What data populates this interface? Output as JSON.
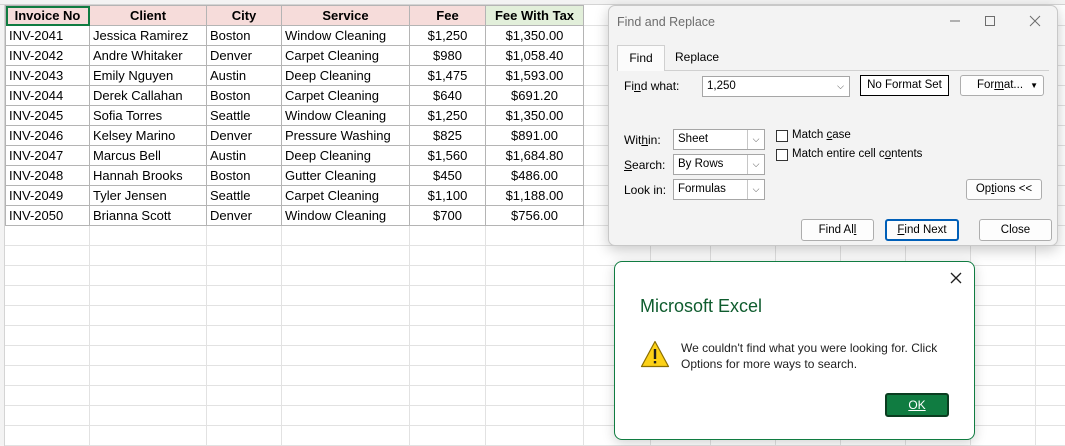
{
  "sheet": {
    "headers": [
      "Invoice No",
      "Client",
      "City",
      "Service",
      "Fee",
      "Fee With Tax"
    ],
    "rows": [
      [
        "INV-2041",
        "Jessica Ramirez",
        "Boston",
        "Window Cleaning",
        "$1,250",
        "$1,350.00"
      ],
      [
        "INV-2042",
        "Andre Whitaker",
        "Denver",
        "Carpet Cleaning",
        "$980",
        "$1,058.40"
      ],
      [
        "INV-2043",
        "Emily Nguyen",
        "Austin",
        "Deep Cleaning",
        "$1,475",
        "$1,593.00"
      ],
      [
        "INV-2044",
        "Derek Callahan",
        "Boston",
        "Carpet Cleaning",
        "$640",
        "$691.20"
      ],
      [
        "INV-2045",
        "Sofia Torres",
        "Seattle",
        "Window Cleaning",
        "$1,250",
        "$1,350.00"
      ],
      [
        "INV-2046",
        "Kelsey Marino",
        "Denver",
        "Pressure Washing",
        "$825",
        "$891.00"
      ],
      [
        "INV-2047",
        "Marcus Bell",
        "Austin",
        "Deep Cleaning",
        "$1,560",
        "$1,684.80"
      ],
      [
        "INV-2048",
        "Hannah Brooks",
        "Boston",
        "Gutter Cleaning",
        "$450",
        "$486.00"
      ],
      [
        "INV-2049",
        "Tyler Jensen",
        "Seattle",
        "Carpet Cleaning",
        "$1,100",
        "$1,188.00"
      ],
      [
        "INV-2050",
        "Brianna Scott",
        "Denver",
        "Window Cleaning",
        "$700",
        "$756.00"
      ]
    ]
  },
  "find_dialog": {
    "title": "Find and Replace",
    "tabs": {
      "find": "Find",
      "replace": "Replace"
    },
    "find_what": {
      "label_pre": "Fi",
      "label_key": "n",
      "label_post": "d what:",
      "value": "1,250"
    },
    "no_format": "No Format Set",
    "format_btn": {
      "pre": "For",
      "key": "m",
      "post": "at..."
    },
    "within": {
      "label_pre": "Wit",
      "label_key": "h",
      "label_post": "in:",
      "value": "Sheet"
    },
    "search": {
      "label_key": "S",
      "label_post": "earch:",
      "value": "By Rows"
    },
    "look_in": {
      "label_pre": "Look in:",
      "value": "Formulas"
    },
    "match_case": {
      "pre": "Match ",
      "key": "c",
      "post": "ase"
    },
    "match_entire": {
      "pre": "Match entire cell c",
      "key": "o",
      "post": "ntents"
    },
    "options": {
      "pre": "Op",
      "key": "t",
      "post": "ions <<"
    },
    "find_all": {
      "pre": "Find Al",
      "key": "l",
      "post": ""
    },
    "find_next": {
      "pre": "",
      "key": "F",
      "post": "ind Next"
    },
    "close": "Close"
  },
  "message_box": {
    "title": "Microsoft Excel",
    "text": "We couldn't find what you were looking for. Click Options for more ways to search.",
    "ok": "OK"
  },
  "colors": {
    "header_fill": "#f6dcda",
    "tax_header_fill": "#e2efda",
    "excel_green": "#107c41"
  },
  "icons": [
    "warning-icon",
    "close-icon",
    "minimize-icon",
    "maximize-icon",
    "chevron-down-icon"
  ]
}
